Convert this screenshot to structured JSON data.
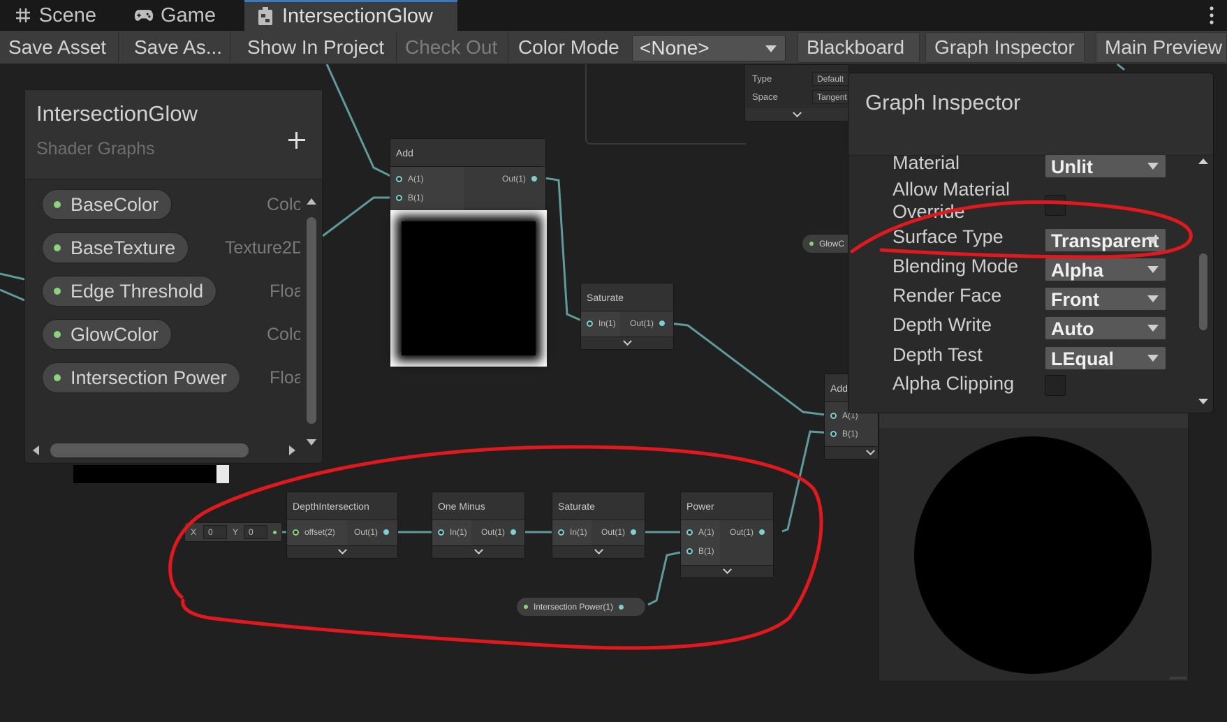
{
  "tabs": [
    {
      "label": "Scene",
      "icon": "grid-hash-icon"
    },
    {
      "label": "Game",
      "icon": "gamepad-icon"
    },
    {
      "label": "IntersectionGlow",
      "icon": "shader-graph-icon",
      "active": true
    }
  ],
  "toolbar": {
    "save_asset": "Save Asset",
    "save_as": "Save As...",
    "show_in_project": "Show In Project",
    "check_out": "Check Out",
    "color_mode_label": "Color Mode",
    "color_mode_value": "<None>",
    "blackboard": "Blackboard",
    "graph_inspector": "Graph Inspector",
    "main_preview": "Main Preview"
  },
  "blackboard": {
    "title": "IntersectionGlow",
    "subtitle": "Shader Graphs",
    "properties": [
      {
        "name": "BaseColor",
        "type": "Colo"
      },
      {
        "name": "BaseTexture",
        "type": "Texture2D"
      },
      {
        "name": "Edge Threshold",
        "type": "Floa"
      },
      {
        "name": "GlowColor",
        "type": "Colo"
      },
      {
        "name": "Intersection Power",
        "type": "Floa"
      }
    ]
  },
  "top_panel": {
    "type_label": "Type",
    "type_value": "Default",
    "space_label": "Space",
    "space_value": "Tangent"
  },
  "nodes": {
    "add_top": {
      "title": "Add",
      "in_a": "A(1)",
      "in_b": "B(1)",
      "out": "Out(1)"
    },
    "saturate_top": {
      "title": "Saturate",
      "in": "In(1)",
      "out": "Out(1)"
    },
    "add_right": {
      "title": "Add",
      "in_a": "A(1)",
      "in_b": "B(1)"
    },
    "glow_pill": "GlowC",
    "offset_x_label": "X",
    "offset_x": "0",
    "offset_y_label": "Y",
    "offset_y": "0",
    "depth": {
      "title": "DepthIntersection",
      "in": "offset(2)",
      "out": "Out(1)"
    },
    "one_minus": {
      "title": "One Minus",
      "in": "In(1)",
      "out": "Out(1)"
    },
    "saturate_bottom": {
      "title": "Saturate",
      "in": "In(1)",
      "out": "Out(1)"
    },
    "power": {
      "title": "Power",
      "in_a": "A(1)",
      "in_b": "B(1)",
      "out": "Out(1)"
    },
    "intersection_power_pill": "Intersection Power(1)"
  },
  "inspector": {
    "title": "Graph Inspector",
    "rows": [
      {
        "label": "Material",
        "value": "Unlit",
        "kind": "dropdown"
      },
      {
        "label": "Allow Material Override",
        "kind": "checkbox"
      },
      {
        "label": "Surface Type",
        "value": "Transparent",
        "kind": "dropdown"
      },
      {
        "label": "Blending Mode",
        "value": "Alpha",
        "kind": "dropdown"
      },
      {
        "label": "Render Face",
        "value": "Front",
        "kind": "dropdown"
      },
      {
        "label": "Depth Write",
        "value": "Auto",
        "kind": "dropdown"
      },
      {
        "label": "Depth Test",
        "value": "LEqual",
        "kind": "dropdown"
      },
      {
        "label": "Alpha Clipping",
        "kind": "checkbox"
      }
    ]
  },
  "colors": {
    "wire": "#5f9a9c",
    "annotation": "#e0191e",
    "port": "#7ecfd0",
    "pill_dot": "#8bd47a",
    "active_tab_accent": "#3a79bb"
  }
}
